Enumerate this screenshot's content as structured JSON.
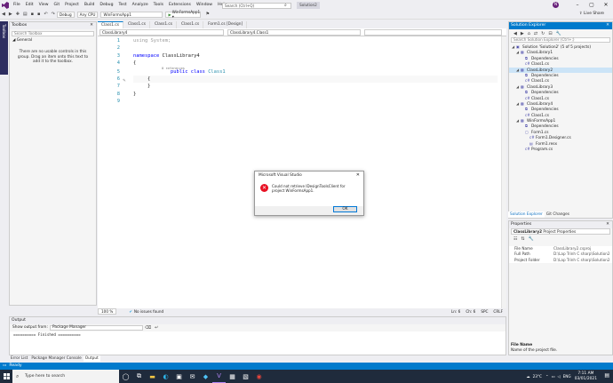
{
  "menu": [
    "File",
    "Edit",
    "View",
    "Git",
    "Project",
    "Build",
    "Debug",
    "Test",
    "Analyze",
    "Tools",
    "Extensions",
    "Window",
    "Help"
  ],
  "search_placeholder": "Search (Ctrl+Q)",
  "solution_name": "Solution2",
  "account_initial": "N",
  "live_share": "Live Share",
  "toolbar": {
    "config": "Debug",
    "platform": "Any CPU",
    "startup": "WinFormsApp1",
    "run": "WinFormsApp1 ▾"
  },
  "toolbox": {
    "tab_label": "Toolbox",
    "title": "Toolbox",
    "search_placeholder": "Search Toolbox",
    "group": "◢ General",
    "empty_message": "There are no usable controls in this group. Drag an item onto this text to add it to the toolbox."
  },
  "editor_tabs": [
    "Class1.cs",
    "Class1.cs",
    "Class1.cs",
    "Class1.cs",
    "Form1.cs [Design]"
  ],
  "nav": {
    "project": "ClassLibrary4",
    "type": "ClassLibrary4.Class1",
    "member": ""
  },
  "code": {
    "line_numbers": [
      "1",
      "2",
      "3",
      "4",
      "5",
      "6",
      "7",
      "8",
      "9"
    ],
    "lines": [
      "",
      "",
      "",
      "",
      "",
      "",
      "",
      "",
      ""
    ],
    "using_kw": "using",
    "using_ns": "System;",
    "namespace_kw": "namespace",
    "namespace_name": "ClassLibrary4",
    "refs": "0 references",
    "public_kw": "public",
    "class_kw": "class",
    "class_name": "Class1",
    "brace_open": "{",
    "brace_close": "}"
  },
  "editor_status": {
    "zoom": "100 %",
    "issues": "No issues found",
    "ln": "Ln: 6",
    "ch": "Ch: 6",
    "spc": "SPC",
    "crlf": "CRLF"
  },
  "output": {
    "title": "Output",
    "show_from_label": "Show output from:",
    "source": "Package Manager",
    "text": "========== Finished =========="
  },
  "bottom_tabs": [
    "Error List",
    "Package Manager Console",
    "Output"
  ],
  "status": "Ready",
  "solution_explorer": {
    "title": "Solution Explorer",
    "search_placeholder": "Search Solution Explorer (Ctrl+;)",
    "tree": [
      {
        "label": "Solution 'Solution2' (5 of 5 projects)",
        "icon": "solution-icon",
        "level": 0
      },
      {
        "label": "ClassLibrary1",
        "icon": "project-icon",
        "level": 1
      },
      {
        "label": "Dependencies",
        "icon": "dependencies-icon",
        "level": 2
      },
      {
        "label": "Class1.cs",
        "icon": "csharp-file-icon",
        "level": 2
      },
      {
        "label": "ClassLibrary2",
        "icon": "project-icon",
        "level": 1,
        "selected": true
      },
      {
        "label": "Dependencies",
        "icon": "dependencies-icon",
        "level": 2
      },
      {
        "label": "Class1.cs",
        "icon": "csharp-file-icon",
        "level": 2
      },
      {
        "label": "ClassLibrary3",
        "icon": "project-icon",
        "level": 1
      },
      {
        "label": "Dependencies",
        "icon": "dependencies-icon",
        "level": 2
      },
      {
        "label": "Class1.cs",
        "icon": "csharp-file-icon",
        "level": 2
      },
      {
        "label": "ClassLibrary4",
        "icon": "project-icon",
        "level": 1
      },
      {
        "label": "Dependencies",
        "icon": "dependencies-icon",
        "level": 2
      },
      {
        "label": "Class1.cs",
        "icon": "csharp-file-icon",
        "level": 2
      },
      {
        "label": "WinFormsApp1",
        "icon": "project-icon",
        "level": 1
      },
      {
        "label": "Dependencies",
        "icon": "dependencies-icon",
        "level": 2
      },
      {
        "label": "Form1.cs",
        "icon": "form-icon",
        "level": 2
      },
      {
        "label": "Form1.Designer.cs",
        "icon": "csharp-file-icon",
        "level": 3
      },
      {
        "label": "Form1.resx",
        "icon": "resx-icon",
        "level": 3
      },
      {
        "label": "Program.cs",
        "icon": "csharp-file-icon",
        "level": 2
      }
    ]
  },
  "se_tabs": [
    "Solution Explorer",
    "Git Changes"
  ],
  "properties": {
    "title": "Properties",
    "object": "ClassLibrary2",
    "object_type": "Project Properties",
    "rows": [
      {
        "name": "File Name",
        "value": "ClassLibrary2.csproj"
      },
      {
        "name": "Full Path",
        "value": "D:\\Lap Trinh C sharp\\Solution2"
      },
      {
        "name": "Project Folder",
        "value": "D:\\Lap Trinh C sharp\\Solution2"
      }
    ],
    "desc_title": "File Name",
    "desc_text": "Name of the project file."
  },
  "dialog": {
    "title": "Microsoft Visual Studio",
    "message": "Could not retrieve IDesignToolsClient for project WinFormsApp1.",
    "ok": "OK"
  },
  "taskbar": {
    "search_placeholder": "Type here to search",
    "temperature": "23°C",
    "lang": "ENG",
    "time": "7:11 AM",
    "date": "03/01/2021"
  }
}
